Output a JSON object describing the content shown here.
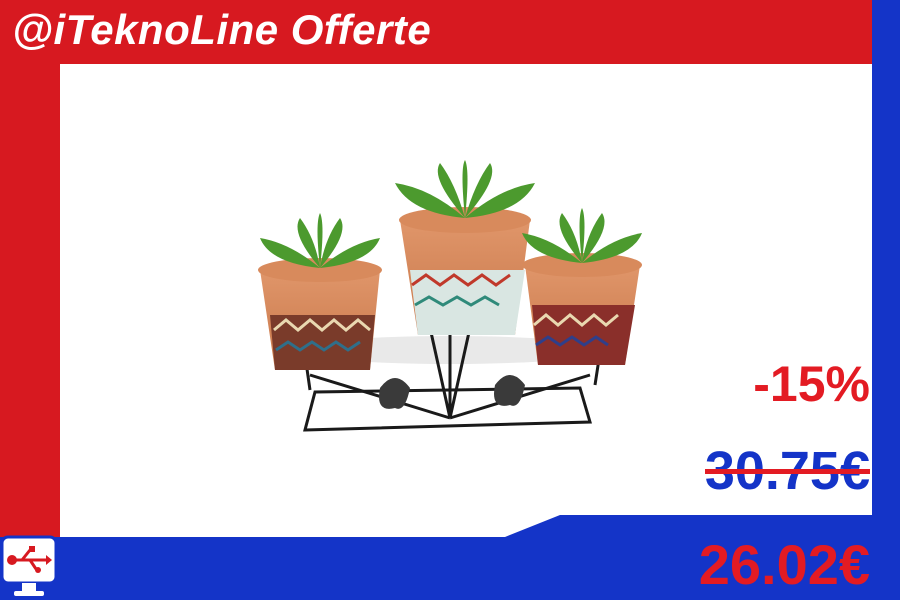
{
  "header": {
    "title": "@iTeknoLine Offerte"
  },
  "product": {
    "image_icon": "succulent-pots-icon"
  },
  "pricing": {
    "discount": "-15%",
    "old_price": "30.75€",
    "new_price": "26.02€"
  },
  "logo": {
    "icon": "usb-monitor-icon"
  },
  "colors": {
    "red": "#d71920",
    "blue": "#1434c8",
    "price_red": "#e31b23"
  }
}
